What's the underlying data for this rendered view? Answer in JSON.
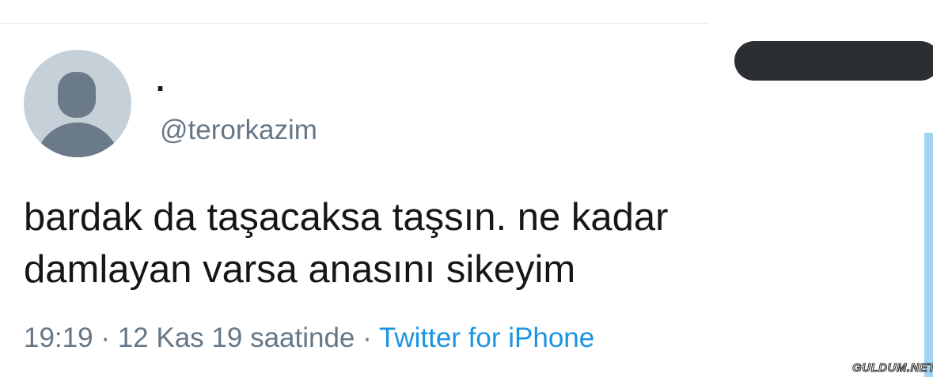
{
  "tweet": {
    "display_name": ".",
    "handle": "@terorkazim",
    "text_line1": "bardak da taşacaksa taşsın. ne kadar",
    "text_line2": "damlayan varsa anasını sikeyim",
    "time": "19:19",
    "date": "12 Kas 19 saatinde",
    "separator": "·",
    "source": "Twitter for iPhone"
  },
  "watermark": "GULDUM.NET",
  "colors": {
    "text": "#14171a",
    "secondary": "#657786",
    "link": "#1b95e0",
    "avatar_bg": "#c6d0d9",
    "avatar_fg": "#6b7a89",
    "follow_button": "#2b2f33",
    "accent_bar": "#9fd3f1"
  },
  "icons": {
    "avatar": "default-profile-avatar-icon"
  }
}
